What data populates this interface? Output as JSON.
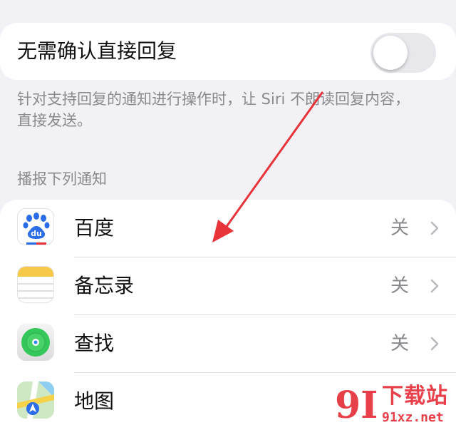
{
  "toggle_setting": {
    "label": "无需确认直接回复",
    "enabled": false
  },
  "footnote": "针对支持回复的通知进行操作时，让 Siri 不朗读回复内容，直接发送。",
  "section_header": "播报下列通知",
  "apps": [
    {
      "name": "百度",
      "status": "关",
      "icon": "baidu-icon"
    },
    {
      "name": "备忘录",
      "status": "关",
      "icon": "notes-icon"
    },
    {
      "name": "查找",
      "status": "关",
      "icon": "find-my-icon"
    },
    {
      "name": "地图",
      "status": "",
      "icon": "maps-icon"
    }
  ],
  "watermark": {
    "title": "下载站",
    "url": "91xz.net",
    "logo": "9I"
  },
  "colors": {
    "background": "#f2f2f6",
    "card": "#ffffff",
    "secondary_text": "#8a8a8e",
    "arrow": "#e8333a"
  }
}
